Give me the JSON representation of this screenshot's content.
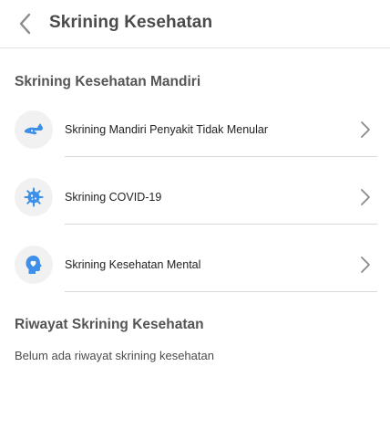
{
  "header": {
    "title": "Skrining Kesehatan",
    "back_icon": "chevron-left-icon"
  },
  "section_screening": {
    "title": "Skrining Kesehatan Mandiri",
    "items": [
      {
        "label": "Skrining Mandiri Penyakit Tidak Menular",
        "icon": "blood-drop-hand-icon"
      },
      {
        "label": "Skrining COVID-19",
        "icon": "virus-icon"
      },
      {
        "label": "Skrining Kesehatan Mental",
        "icon": "head-heart-icon"
      }
    ]
  },
  "section_history": {
    "title": "Riwayat Skrining Kesehatan",
    "empty_text": "Belum ada riwayat skrining kesehatan"
  },
  "colors": {
    "accent": "#3d8fe8",
    "icon_bg": "#f1f1f1",
    "divider": "#d9d9d9"
  }
}
